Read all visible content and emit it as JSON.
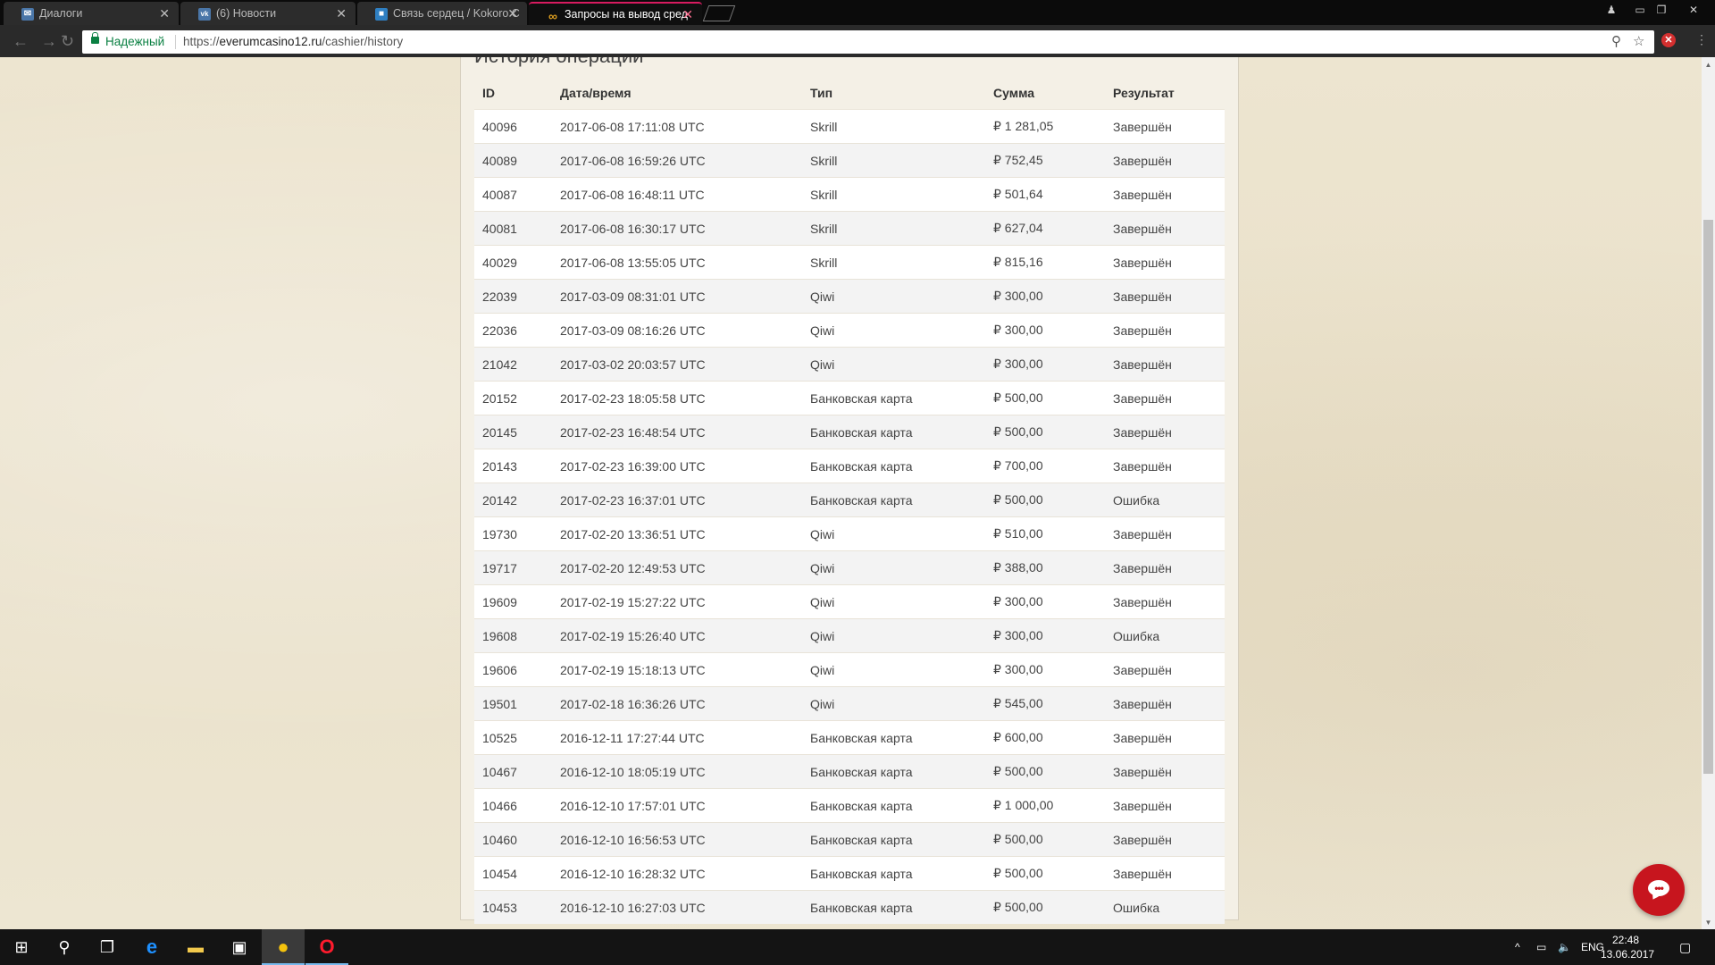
{
  "browser": {
    "tabs": [
      {
        "title": "Диалоги",
        "favicon": "vk-messages-icon",
        "color": "#4a76a8",
        "glyph": "✉"
      },
      {
        "title": "(6) Новости",
        "favicon": "vk-icon",
        "color": "#4a76a8",
        "glyph": "vk"
      },
      {
        "title": "Связь сердец / Kokoro C",
        "favicon": "bookmark-icon",
        "color": "#2f7fc1",
        "glyph": "■"
      },
      {
        "title": "Запросы на вывод сред",
        "favicon": "casino-icon",
        "color": "#e0a020",
        "glyph": "∞"
      }
    ],
    "secure_label": "Надежный",
    "url_prefix": "https://",
    "url_host": "everumcasino12.ru",
    "url_path": "/cashier/history"
  },
  "page": {
    "section_title": "История операций",
    "columns": [
      "ID",
      "Дата/время",
      "Тип",
      "Сумма",
      "Результат"
    ],
    "rows": [
      [
        "40096",
        "2017-06-08 17:11:08 UTC",
        "Skrill",
        "₽ 1 281,05",
        "Завершён"
      ],
      [
        "40089",
        "2017-06-08 16:59:26 UTC",
        "Skrill",
        "₽ 752,45",
        "Завершён"
      ],
      [
        "40087",
        "2017-06-08 16:48:11 UTC",
        "Skrill",
        "₽ 501,64",
        "Завершён"
      ],
      [
        "40081",
        "2017-06-08 16:30:17 UTC",
        "Skrill",
        "₽ 627,04",
        "Завершён"
      ],
      [
        "40029",
        "2017-06-08 13:55:05 UTC",
        "Skrill",
        "₽ 815,16",
        "Завершён"
      ],
      [
        "22039",
        "2017-03-09 08:31:01 UTC",
        "Qiwi",
        "₽ 300,00",
        "Завершён"
      ],
      [
        "22036",
        "2017-03-09 08:16:26 UTC",
        "Qiwi",
        "₽ 300,00",
        "Завершён"
      ],
      [
        "21042",
        "2017-03-02 20:03:57 UTC",
        "Qiwi",
        "₽ 300,00",
        "Завершён"
      ],
      [
        "20152",
        "2017-02-23 18:05:58 UTC",
        "Банковская карта",
        "₽ 500,00",
        "Завершён"
      ],
      [
        "20145",
        "2017-02-23 16:48:54 UTC",
        "Банковская карта",
        "₽ 500,00",
        "Завершён"
      ],
      [
        "20143",
        "2017-02-23 16:39:00 UTC",
        "Банковская карта",
        "₽ 700,00",
        "Завершён"
      ],
      [
        "20142",
        "2017-02-23 16:37:01 UTC",
        "Банковская карта",
        "₽ 500,00",
        "Ошибка"
      ],
      [
        "19730",
        "2017-02-20 13:36:51 UTC",
        "Qiwi",
        "₽ 510,00",
        "Завершён"
      ],
      [
        "19717",
        "2017-02-20 12:49:53 UTC",
        "Qiwi",
        "₽ 388,00",
        "Завершён"
      ],
      [
        "19609",
        "2017-02-19 15:27:22 UTC",
        "Qiwi",
        "₽ 300,00",
        "Завершён"
      ],
      [
        "19608",
        "2017-02-19 15:26:40 UTC",
        "Qiwi",
        "₽ 300,00",
        "Ошибка"
      ],
      [
        "19606",
        "2017-02-19 15:18:13 UTC",
        "Qiwi",
        "₽ 300,00",
        "Завершён"
      ],
      [
        "19501",
        "2017-02-18 16:36:26 UTC",
        "Qiwi",
        "₽ 545,00",
        "Завершён"
      ],
      [
        "10525",
        "2016-12-11 17:27:44 UTC",
        "Банковская карта",
        "₽ 600,00",
        "Завершён"
      ],
      [
        "10467",
        "2016-12-10 18:05:19 UTC",
        "Банковская карта",
        "₽ 500,00",
        "Завершён"
      ],
      [
        "10466",
        "2016-12-10 17:57:01 UTC",
        "Банковская карта",
        "₽ 1 000,00",
        "Завершён"
      ],
      [
        "10460",
        "2016-12-10 16:56:53 UTC",
        "Банковская карта",
        "₽ 500,00",
        "Завершён"
      ],
      [
        "10454",
        "2016-12-10 16:28:32 UTC",
        "Банковская карта",
        "₽ 500,00",
        "Завершён"
      ],
      [
        "10453",
        "2016-12-10 16:27:03 UTC",
        "Банковская карта",
        "₽ 500,00",
        "Ошибка"
      ]
    ]
  },
  "chat_widget": {
    "icon": "chat-bubble-icon",
    "color": "#c7151e"
  },
  "taskbar": {
    "items": [
      {
        "name": "start-button",
        "icon": "windows-icon",
        "glyph": "⊞"
      },
      {
        "name": "search-button",
        "icon": "search-icon",
        "glyph": "⌕"
      },
      {
        "name": "task-view-button",
        "icon": "task-view-icon",
        "glyph": "❐"
      },
      {
        "name": "edge-button",
        "icon": "edge-icon",
        "glyph": "e"
      },
      {
        "name": "explorer-button",
        "icon": "folder-icon",
        "glyph": "▬"
      },
      {
        "name": "store-button",
        "icon": "store-icon",
        "glyph": "▣"
      },
      {
        "name": "chrome-button",
        "icon": "chrome-icon",
        "glyph": "●"
      },
      {
        "name": "opera-button",
        "icon": "opera-icon",
        "glyph": "O"
      }
    ],
    "language": "ENG",
    "time": "22:48",
    "date": "13.06.2017"
  }
}
